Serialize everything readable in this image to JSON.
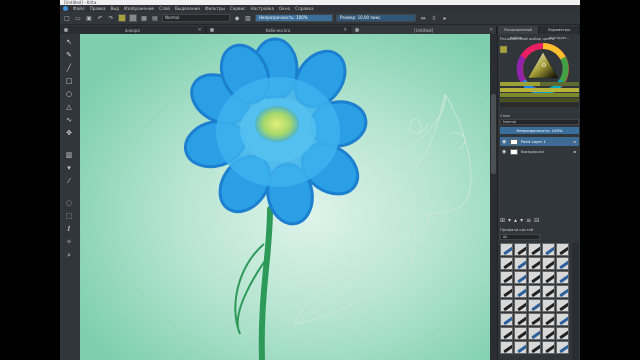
{
  "app": {
    "title": "[Untitled] - Krita"
  },
  "menu": {
    "items": [
      "Файл",
      "Правка",
      "Вид",
      "Изображение",
      "Слой",
      "Выделение",
      "Фильтры",
      "Сервис",
      "Настройка",
      "Окно",
      "Справка"
    ]
  },
  "toolbar": {
    "blend_mode": "Normal",
    "opacity_label": "Непрозрачность: 100%",
    "size_label": "Размер: 10,00 пикс.",
    "fg_color": "#a8a038",
    "bg_color": "#888888"
  },
  "tabs": [
    {
      "label": "анкора"
    },
    {
      "label": "бабочка.kra"
    },
    {
      "label": "[Untitled]"
    }
  ],
  "right_panel": {
    "tabs": [
      "Расширенный выбор...",
      "Параметры инструм..."
    ],
    "color_selector_title": "Расширенный выбор цвета",
    "layers_title": "Слои",
    "blend_mode": "Normal",
    "opacity": "Непрозрачность: 100%",
    "layers": [
      {
        "name": "Paint Layer 1",
        "selected": true
      },
      {
        "name": "Background",
        "selected": false
      }
    ],
    "brush_presets_title": "Профили кистей",
    "brush_tag": "All"
  },
  "colors": {
    "canvas_bg": "#8fd3b8",
    "flower_blue": "#2a9fe6",
    "stem_green": "#2e9a5a",
    "accent": "#3a6f9b"
  }
}
